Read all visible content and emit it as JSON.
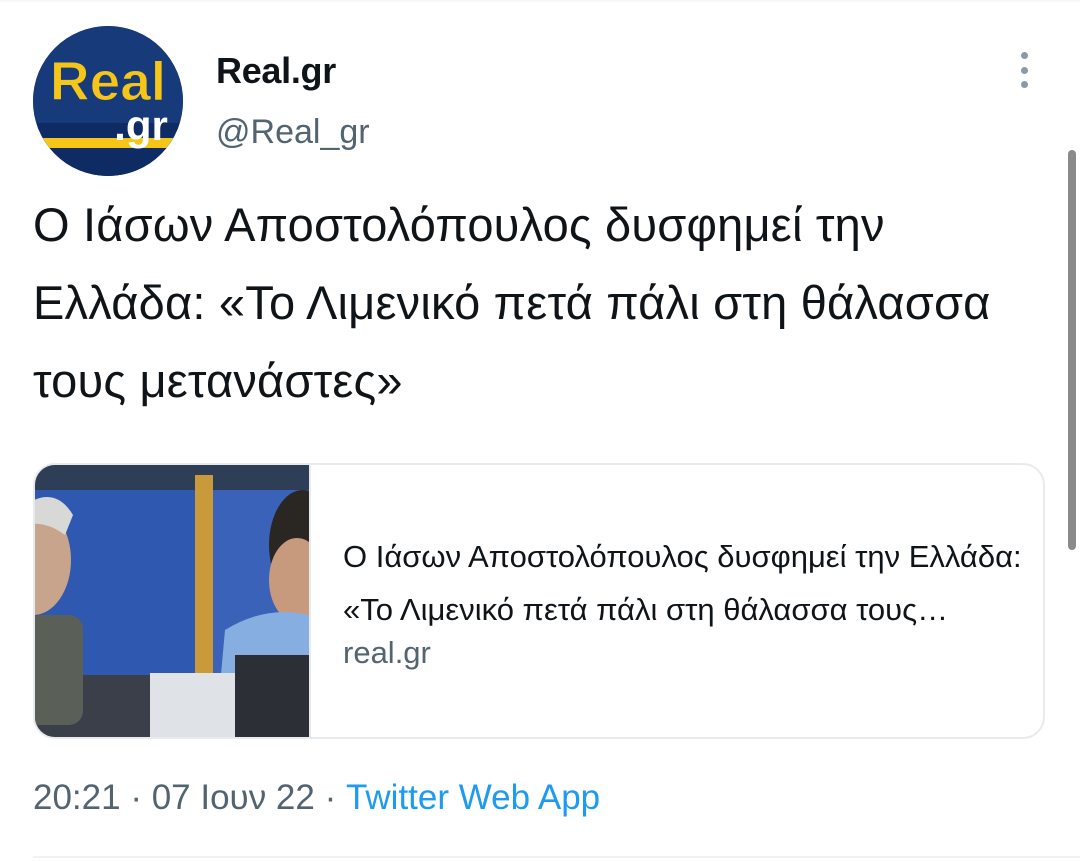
{
  "author": {
    "name": "Real.gr",
    "handle": "@Real_gr",
    "avatar_text_top": "Real",
    "avatar_text_bottom": ".gr"
  },
  "tweet": {
    "text": "Ο Ιάσων Αποστολόπουλος δυσφημεί την Ελλάδα: «Το Λιμενικό πετά πάλι στη θάλασσα τους μετανάστες»"
  },
  "link_card": {
    "title": "Ο Ιάσων Αποστολόπουλος δυσφημεί την Ελλάδα: «Το Λιμενικό πετά πάλι στη θάλασσα τους μετανάστες»",
    "domain": "real.gr"
  },
  "meta": {
    "time": "20:21",
    "separator_1": " · ",
    "date": "07 Ιουν 22",
    "separator_2": " · ",
    "source": "Twitter Web App"
  },
  "icons": {
    "more": "more-vertical-icon"
  },
  "colors": {
    "link_blue": "#1d9bf0",
    "secondary_text": "#536471",
    "avatar_navy": "#173a7a",
    "avatar_yellow": "#f5c518"
  }
}
